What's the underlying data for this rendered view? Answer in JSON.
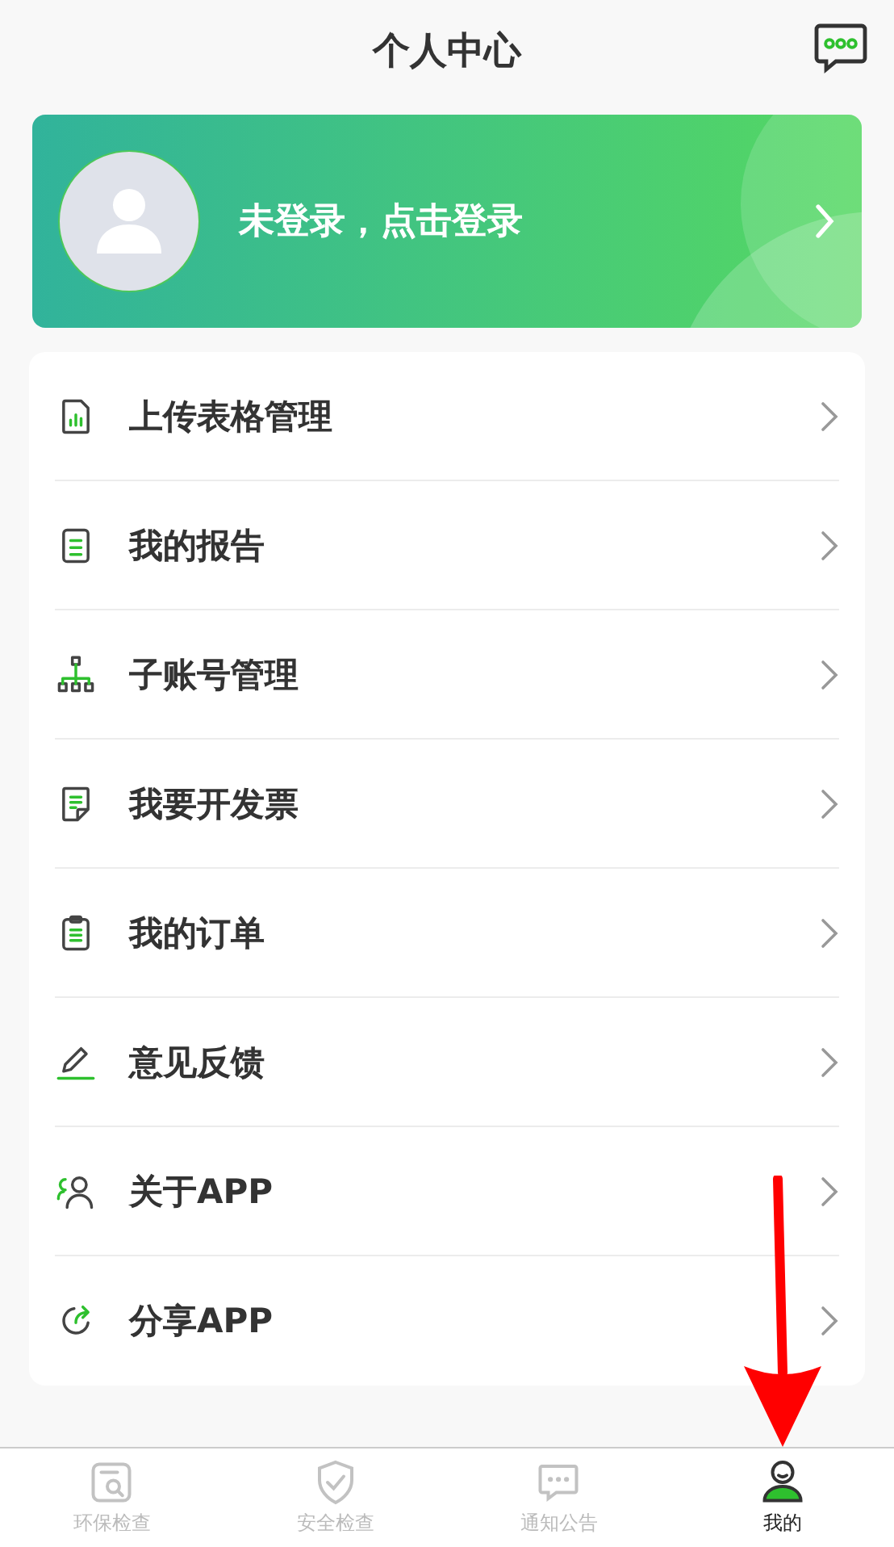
{
  "header": {
    "title": "个人中心"
  },
  "profile": {
    "login_text": "未登录，点击登录"
  },
  "menu": [
    {
      "kind": "sheet",
      "label": "上传表格管理"
    },
    {
      "kind": "report",
      "label": "我的报告"
    },
    {
      "kind": "org",
      "label": "子账号管理"
    },
    {
      "kind": "invoice",
      "label": "我要开发票"
    },
    {
      "kind": "clipboard",
      "label": "我的订单"
    },
    {
      "kind": "pencil",
      "label": "意见反馈"
    },
    {
      "kind": "users",
      "label": "关于APP"
    },
    {
      "kind": "share",
      "label": "分享APP"
    }
  ],
  "tab_bar": [
    {
      "kind": "inspect",
      "label": "环保检查",
      "selected": false
    },
    {
      "kind": "shield",
      "label": "安全检查",
      "selected": false
    },
    {
      "kind": "chat",
      "label": "通知公告",
      "selected": false
    },
    {
      "kind": "person",
      "label": "我的",
      "selected": true
    }
  ]
}
